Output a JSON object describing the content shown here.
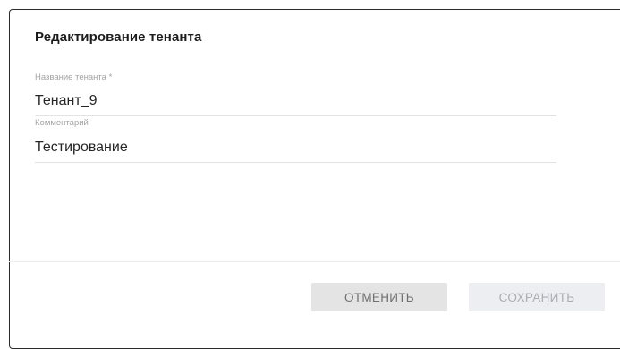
{
  "dialog": {
    "title": "Редактирование тенанта",
    "fields": {
      "name": {
        "label": "Название тенанта *",
        "value": "Тенант_9"
      },
      "comment": {
        "label": "Комментарий",
        "value": "Тестирование"
      }
    },
    "buttons": {
      "cancel": "ОТМЕНИТЬ",
      "save": "СОХРАНИТЬ"
    }
  }
}
